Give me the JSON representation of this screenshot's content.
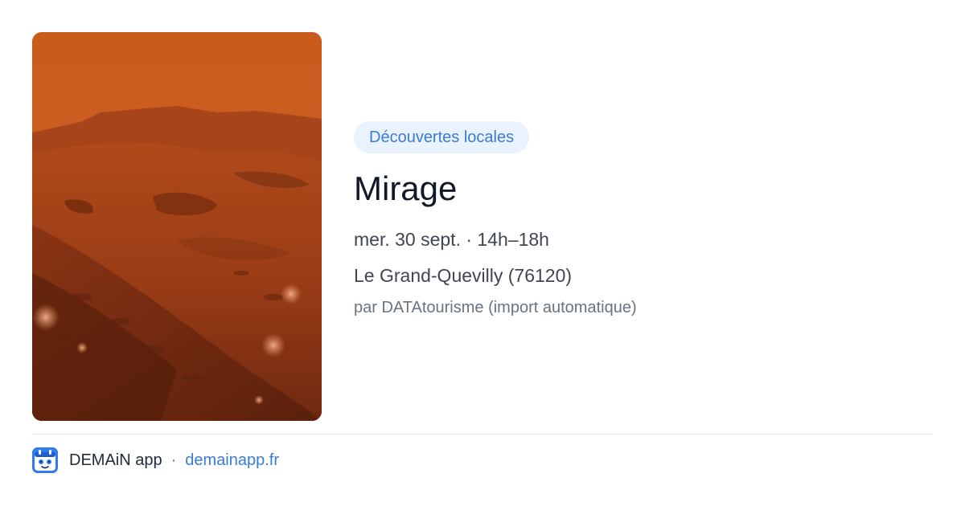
{
  "event": {
    "category": "Découvertes locales",
    "title": "Mirage",
    "date": "mer. 30 sept. · 14h–18h",
    "location": "Le Grand-Quevilly (76120)",
    "source": "par DATAtourisme (import automatique)",
    "image_description_icon": "mars-landscape-photo"
  },
  "footer": {
    "app_name": "DEMAiN app",
    "separator": "·",
    "link": "demainapp.fr",
    "logo_icon": "calendar-mascot-icon"
  },
  "colors": {
    "accent": "#3a7bd5",
    "tag_background": "#eaf2fd",
    "title": "#111827",
    "muted": "#6b7280",
    "logo": "#2e7cf0"
  }
}
